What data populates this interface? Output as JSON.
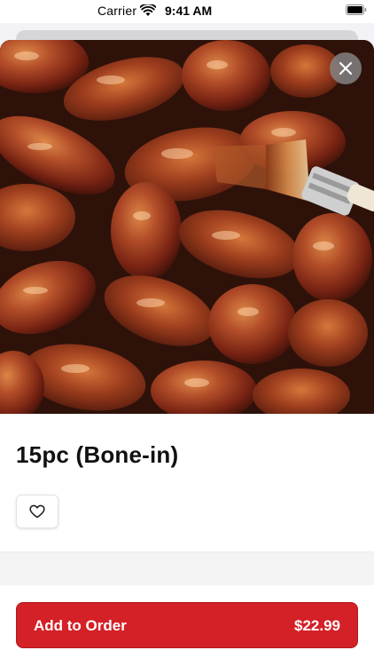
{
  "status_bar": {
    "carrier": "Carrier",
    "time": "9:41 AM",
    "icons": [
      "wifi-icon",
      "battery-icon"
    ]
  },
  "product": {
    "title": "15pc (Bone-in)",
    "image": "bbq-chicken-wings-photo",
    "close_icon": "close-icon",
    "favorite_icon": "heart-outline-icon"
  },
  "cta": {
    "label": "Add to Order",
    "price": "$22.99",
    "color": "#d42027"
  }
}
